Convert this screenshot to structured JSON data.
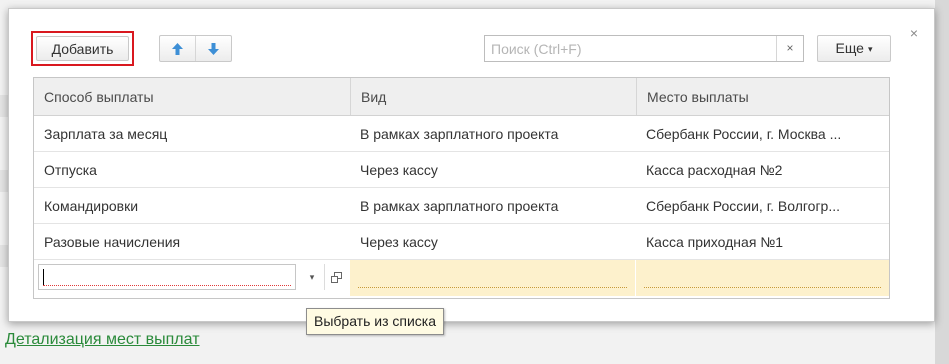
{
  "toolbar": {
    "add_label": "Добавить",
    "move_up_icon": "arrow-up-icon",
    "move_down_icon": "arrow-down-icon",
    "search_placeholder": "Поиск (Ctrl+F)",
    "search_value": "",
    "clear_label": "×",
    "more_label": "Еще",
    "more_caret": "▾"
  },
  "close_label": "×",
  "table": {
    "columns": [
      "Способ выплаты",
      "Вид",
      "Место выплаты"
    ],
    "rows": [
      [
        "Зарплата за месяц",
        "В рамках зарплатного проекта",
        "Сбербанк России, г. Москва ..."
      ],
      [
        "Отпуска",
        "Через кассу",
        "Касса расходная №2"
      ],
      [
        "Командировки",
        "В рамках зарплатного проекта",
        "Сбербанк России, г. Волгогр..."
      ],
      [
        "Разовые начисления",
        "Через кассу",
        "Касса приходная №1"
      ]
    ],
    "edit_row": {
      "value": "",
      "dropdown_glyph": "▾",
      "open_icon": "open-form-icon"
    }
  },
  "tooltip": "Выбрать из списка",
  "footer_link": "Детализация мест выплат",
  "colors": {
    "highlight_border": "#d9181f",
    "arrow_blue": "#3d8fd6",
    "edit_row_fill": "#fdf1cc",
    "link": "#2a8a3a"
  }
}
